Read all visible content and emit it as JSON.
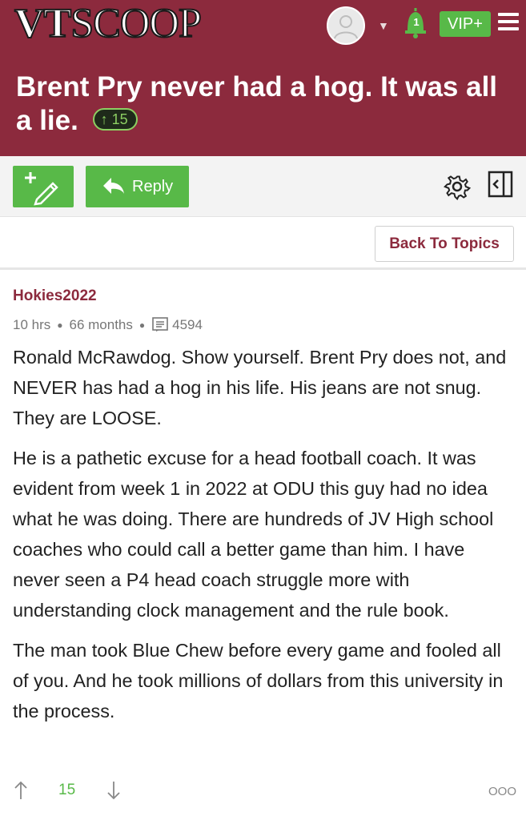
{
  "header": {
    "logo_vt": "VT",
    "logo_scoop": "SCOOP",
    "notification_count": "1",
    "vip_label": "VIP+",
    "title": "Brent Pry never had a hog. It was all a lie.",
    "upvote_badge": "15",
    "colors": {
      "brand": "#8c2a3d",
      "accent": "#58b948"
    }
  },
  "toolbar": {
    "reply_label": "Reply",
    "back_label": "Back To Topics",
    "icons": [
      "new-post-icon",
      "reply-arrow-icon",
      "gear-icon",
      "collapse-sidebar-icon"
    ]
  },
  "post": {
    "author": "Hokies2022",
    "posted": "10 hrs",
    "member_for": "66 months",
    "post_count": "4594",
    "paragraphs": [
      "Ronald McRawdog. Show yourself. Brent Pry does not, and NEVER has had a hog in his life. His jeans are not snug. They are LOOSE.",
      "He is a pathetic excuse for a head football coach. It was evident from week 1 in 2022 at ODU this guy had no idea what he was doing. There are hundreds of JV High school coaches who could call a better game than him. I have never seen a P4 head coach struggle more with understanding clock management and the rule book.",
      "The man took Blue Chew before every game and fooled all of you. And he took millions of dollars from this university in the process."
    ],
    "votes": "15",
    "more": "OOO"
  }
}
